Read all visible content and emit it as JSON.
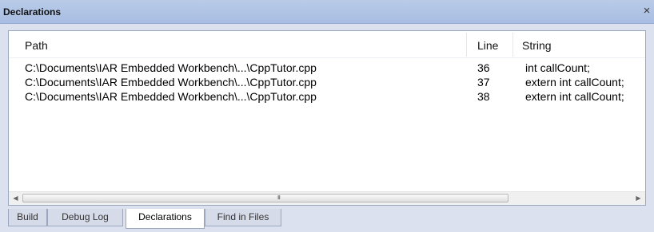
{
  "window": {
    "title": "Declarations",
    "close_glyph": "×"
  },
  "table": {
    "columns": {
      "path": "Path",
      "line": "Line",
      "string": "String"
    },
    "rows": [
      {
        "path": "C:\\Documents\\IAR Embedded Workbench\\...\\CppTutor.cpp",
        "line": "36",
        "string": "int callCount;"
      },
      {
        "path": "C:\\Documents\\IAR Embedded Workbench\\...\\CppTutor.cpp",
        "line": "37",
        "string": "extern int callCount;"
      },
      {
        "path": "C:\\Documents\\IAR Embedded Workbench\\...\\CppTutor.cpp",
        "line": "38",
        "string": "extern int callCount;"
      }
    ]
  },
  "scrollbar": {
    "left_glyph": "◀",
    "right_glyph": "▶",
    "thumb_grip": "III"
  },
  "tabs": [
    {
      "label": "Build",
      "active": false
    },
    {
      "label": "Debug Log",
      "active": false
    },
    {
      "label": "Declarations",
      "active": true
    },
    {
      "label": "Find in Files",
      "active": false
    }
  ]
}
